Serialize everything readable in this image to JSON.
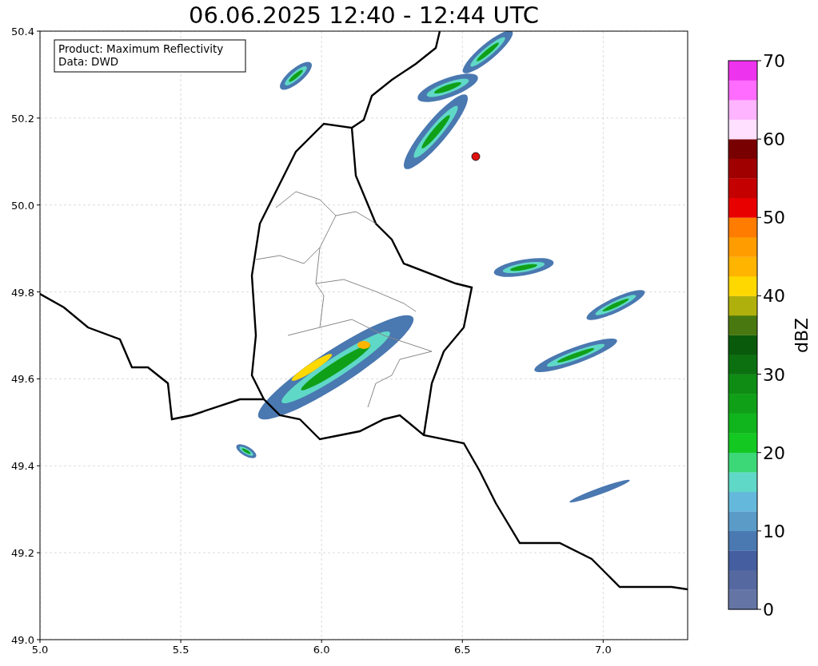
{
  "title": "06.06.2025 12:40 - 12:44 UTC",
  "map": {
    "legend": [
      "Product: Maximum Reflectivity",
      "Data: DWD"
    ],
    "xticks": [
      "5.0",
      "5.5",
      "6.0",
      "6.5",
      "7.0"
    ],
    "yticks": [
      "50.4",
      "50.2",
      "50.0",
      "49.8",
      "49.6",
      "49.4",
      "49.2",
      "49.0"
    ]
  },
  "colorbar": {
    "label": "dBZ",
    "ticks": [
      "70",
      "60",
      "50",
      "40",
      "30",
      "20",
      "10",
      "0"
    ],
    "bins": [
      {
        "color": "#6475a5"
      },
      {
        "color": "#5568a0"
      },
      {
        "color": "#445ea0"
      },
      {
        "color": "#4a78b0"
      },
      {
        "color": "#5a9bc8"
      },
      {
        "color": "#64b8dc"
      },
      {
        "color": "#60d8c8"
      },
      {
        "color": "#3cd878"
      },
      {
        "color": "#14c822"
      },
      {
        "color": "#10b41c"
      },
      {
        "color": "#10a018"
      },
      {
        "color": "#0e8c14"
      },
      {
        "color": "#0c7010"
      },
      {
        "color": "#0a5a0c"
      },
      {
        "color": "#4a7810"
      },
      {
        "color": "#b0b00c"
      },
      {
        "color": "#ffd800"
      },
      {
        "color": "#ffb400"
      },
      {
        "color": "#ff9c00"
      },
      {
        "color": "#ff7c00"
      },
      {
        "color": "#e80000"
      },
      {
        "color": "#c40000"
      },
      {
        "color": "#a00000"
      },
      {
        "color": "#780000"
      },
      {
        "color": "#ffe0ff"
      },
      {
        "color": "#ffb4ff"
      },
      {
        "color": "#ff6cff"
      },
      {
        "color": "#ee33ee"
      }
    ]
  }
}
